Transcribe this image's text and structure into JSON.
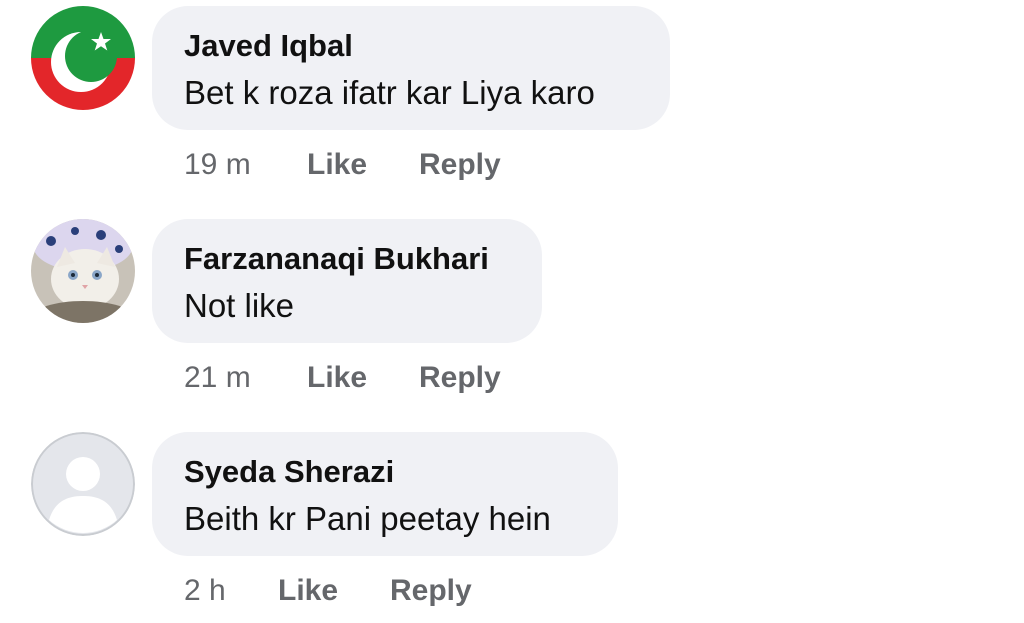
{
  "comments": [
    {
      "author": "Javed Iqbal",
      "text": "Bet k roza ifatr kar Liya karo",
      "time": "19 m",
      "like_label": "Like",
      "reply_label": "Reply",
      "avatar_icon": "flag-crescent-icon"
    },
    {
      "author": "Farzananaqi Bukhari",
      "text": "Not like",
      "time": "21 m",
      "like_label": "Like",
      "reply_label": "Reply",
      "avatar_icon": "cat-photo-avatar"
    },
    {
      "author": "Syeda Sherazi",
      "text": "Beith kr Pani peetay hein",
      "time": "2 h",
      "like_label": "Like",
      "reply_label": "Reply",
      "avatar_icon": "default-user-icon"
    }
  ],
  "colors": {
    "bubble": "#f0f1f5",
    "action_text": "#65676b",
    "flag_green": "#1e9a40",
    "flag_red": "#e3262a"
  }
}
